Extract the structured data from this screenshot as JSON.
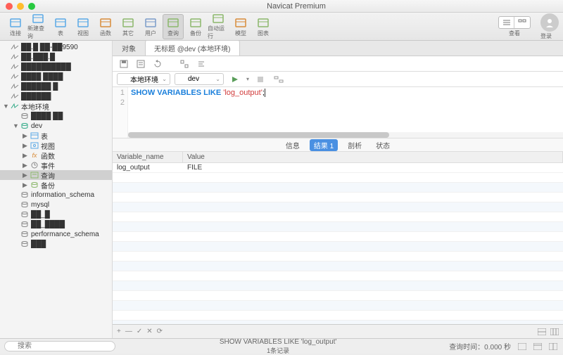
{
  "window": {
    "title": "Navicat Premium"
  },
  "toolbar": {
    "items": [
      {
        "label": "连接",
        "color": "#5aa9e6"
      },
      {
        "label": "新建查询",
        "color": "#5aa9e6"
      },
      {
        "label": "表",
        "color": "#5aa9e6"
      },
      {
        "label": "视图",
        "color": "#5aa9e6"
      },
      {
        "label": "函数",
        "color": "#d88c3a"
      },
      {
        "label": "其它",
        "color": "#8bb76b"
      },
      {
        "label": "用户",
        "color": "#7b9cc9"
      },
      {
        "label": "查询",
        "color": "#8bb76b",
        "active": true
      },
      {
        "label": "备份",
        "color": "#8bb76b"
      },
      {
        "label": "自动运行",
        "color": "#8bb76b"
      },
      {
        "label": "模型",
        "color": "#d88c3a"
      },
      {
        "label": "图表",
        "color": "#8bb76b"
      }
    ],
    "view_label": "查看",
    "login_label": "登录"
  },
  "sidebar": {
    "items": [
      {
        "txt": "██.█ ██-██9590",
        "ind": 0,
        "arr": "",
        "ico": "conn"
      },
      {
        "txt": "██.███.█",
        "ind": 0,
        "arr": "",
        "ico": "conn"
      },
      {
        "txt": "██████████",
        "ind": 0,
        "arr": "",
        "ico": "conn"
      },
      {
        "txt": "████ ████",
        "ind": 0,
        "arr": "",
        "ico": "conn"
      },
      {
        "txt": "██████ █",
        "ind": 0,
        "arr": "",
        "ico": "conn"
      },
      {
        "txt": "██████",
        "ind": 0,
        "arr": "",
        "ico": "conn"
      },
      {
        "txt": "本地环境",
        "ind": 0,
        "arr": "▼",
        "ico": "conn-open"
      },
      {
        "txt": "████ ██",
        "ind": 1,
        "arr": "",
        "ico": "db"
      },
      {
        "txt": "dev",
        "ind": 1,
        "arr": "▼",
        "ico": "db-open"
      },
      {
        "txt": "表",
        "ind": 2,
        "arr": "▶",
        "ico": "table"
      },
      {
        "txt": "视图",
        "ind": 2,
        "arr": "▶",
        "ico": "view"
      },
      {
        "txt": "函数",
        "ind": 2,
        "arr": "▶",
        "ico": "fx"
      },
      {
        "txt": "事件",
        "ind": 2,
        "arr": "▶",
        "ico": "event"
      },
      {
        "txt": "查询",
        "ind": 2,
        "arr": "▶",
        "ico": "query",
        "sel": true
      },
      {
        "txt": "备份",
        "ind": 2,
        "arr": "▶",
        "ico": "backup"
      },
      {
        "txt": "information_schema",
        "ind": 1,
        "arr": "",
        "ico": "db"
      },
      {
        "txt": "mysql",
        "ind": 1,
        "arr": "",
        "ico": "db"
      },
      {
        "txt": "██_█",
        "ind": 1,
        "arr": "",
        "ico": "db"
      },
      {
        "txt": "██_████",
        "ind": 1,
        "arr": "",
        "ico": "db"
      },
      {
        "txt": "performance_schema",
        "ind": 1,
        "arr": "",
        "ico": "db"
      },
      {
        "txt": "███",
        "ind": 1,
        "arr": "",
        "ico": "db"
      }
    ]
  },
  "tabs": {
    "t1": "对象",
    "t2": "无标题 @dev (本地环境)"
  },
  "selectors": {
    "conn": "本地环境",
    "db": "dev"
  },
  "query": {
    "kw1": "SHOW",
    "kw2": "VARIABLES",
    "kw3": "LIKE",
    "str": "'log_output'",
    "semi": ";"
  },
  "result_tabs": {
    "info": "信息",
    "res": "结果 1",
    "profile": "剖析",
    "status": "状态"
  },
  "grid": {
    "cols": {
      "c1": "Variable_name",
      "c2": "Value"
    },
    "row": {
      "c1": "log_output",
      "c2": "FILE"
    }
  },
  "status": {
    "search_ph": "搜索",
    "query_text": "SHOW VARIABLES LIKE 'log_output'",
    "count": "1条记录",
    "time": "查询时间：0.000 秒"
  }
}
